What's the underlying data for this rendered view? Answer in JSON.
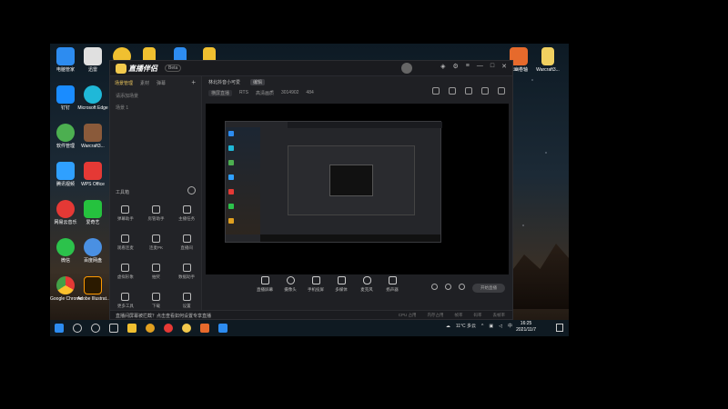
{
  "colors": {
    "accent": "#e7c25c",
    "app_bg": "#1f2024",
    "taskbar": "#0f1a22"
  },
  "desktop_icons": [
    {
      "label": "电脑管家",
      "color": "#2d8cf0",
      "icon": "shield-icon"
    },
    {
      "label": "迅雷",
      "color": "#e0e0e0",
      "icon": "thunder-icon"
    },
    {
      "label": "",
      "color": "#f0c030",
      "icon": "folder-icon"
    },
    {
      "label": "",
      "color": "#f0c030",
      "icon": "note-icon"
    },
    {
      "label": "",
      "color": "#2d8cf0",
      "icon": "folder-icon"
    },
    {
      "label": "",
      "color": "#f0c030",
      "icon": "folder-icon"
    },
    {
      "label": "钉钉",
      "color": "#1a8cff",
      "icon": "dingtalk-icon"
    },
    {
      "label": "Microsoft Edge",
      "color": "#1fb8d8",
      "icon": "edge-icon"
    },
    {
      "label": "软件管理",
      "color": "#4caf50",
      "icon": "apps-icon"
    },
    {
      "label": "Warcraft3...",
      "color": "#8a5a3a",
      "icon": "warcraft-icon"
    },
    {
      "label": "腾讯视频",
      "color": "#2fa0ff",
      "icon": "video-icon"
    },
    {
      "label": "WPS Office",
      "color": "#e53935",
      "icon": "wps-icon"
    },
    {
      "label": "网易云音乐",
      "color": "#e53935",
      "icon": "music-icon"
    },
    {
      "label": "爱奇艺",
      "color": "#25c23e",
      "icon": "iqiyi-icon"
    },
    {
      "label": "微信",
      "color": "#2cc24b",
      "icon": "wechat-icon"
    },
    {
      "label": "百度网盘",
      "color": "#4a90e2",
      "icon": "cloud-icon"
    },
    {
      "label": "Google Chrome",
      "color": "#e0a020",
      "icon": "chrome-icon"
    },
    {
      "label": "Adobe Illustrat...",
      "color": "#ff9a00",
      "icon": "illustrator-icon"
    }
  ],
  "right_icons": [
    {
      "label": "冰幽卷轴",
      "color": "#e66a2c"
    },
    {
      "label": "Warcraft3...",
      "color": "#f0d060"
    }
  ],
  "app": {
    "brand": "直播伴侣",
    "brand_tag": "Beta",
    "sidebar_tabs": [
      "场景管理",
      "素材",
      "弹幕"
    ],
    "sidebar_rows": [
      "请添加场景",
      "场景 1"
    ],
    "tool_header": "工具箱",
    "tools": [
      "弹幕助手",
      "房管助手",
      "主播任务",
      "观看连麦",
      "连麦PK",
      "直播间",
      "虚拟形象",
      "抽奖",
      "数据助手",
      "更多工具",
      "下载",
      "设置"
    ],
    "main_title": "林北抖音小可爱",
    "main_tag": "编辑",
    "meta": [
      "横屏直播",
      "RTS",
      "高清画质",
      "3014902",
      "484"
    ],
    "controls": [
      "直播屏幕",
      "摄像头",
      "手机投屏",
      "多媒体",
      "麦克风",
      "扬声器"
    ],
    "start_label": "开始直播",
    "notice": "直播间屏幕被拦截？点击查看如何设置专享直播",
    "stats": [
      "CPU 占用",
      "内存占用",
      "帧率",
      "码率",
      "丢帧率"
    ]
  },
  "taskbar": {
    "weather": "11°C 多云",
    "time": "16:25",
    "date": "2021/11/7",
    "ime": "中"
  }
}
